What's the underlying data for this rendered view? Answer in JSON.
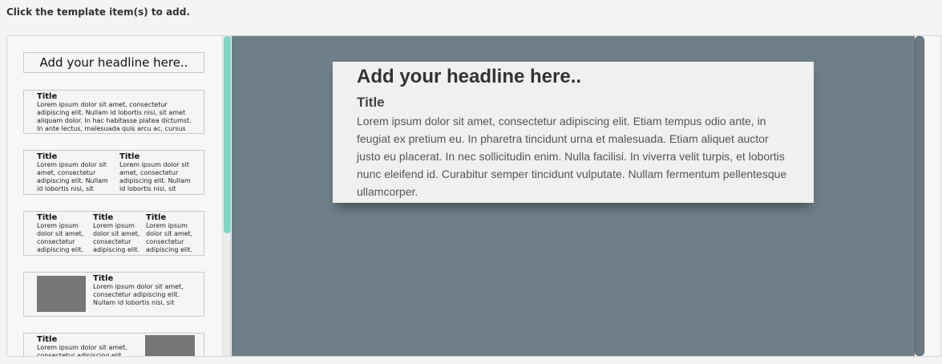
{
  "instruction": "Click the template item(s) to add.",
  "templates": {
    "headline": "Add your headline here..",
    "single": {
      "title": "Title",
      "body": "Lorem ipsum dolor sit amet, consectetur adipiscing elit. Nullam id lobortis nisi, sit amet aliquam dolor. In hac habitasse platea dictumst. In ante lectus, malesuada quis arcu ac, cursus"
    },
    "two_col": [
      {
        "title": "Title",
        "body": "Lorem ipsum dolor sit amet, consectetur adipiscing elit. Nullam id lobortis nisi, sit"
      },
      {
        "title": "Title",
        "body": "Lorem ipsum dolor sit amet, consectetur adipiscing elit. Nullam id lobortis nisi, sit"
      }
    ],
    "three_col": [
      {
        "title": "Title",
        "body": "Lorem ipsum dolor sit amet, consectetur adipiscing elit."
      },
      {
        "title": "Title",
        "body": "Lorem ipsum dolor sit amet, consectetur adipiscing elit."
      },
      {
        "title": "Title",
        "body": "Lorem ipsum dolor sit amet, consectetur adipiscing elit."
      }
    ],
    "image_left": {
      "title": "Title",
      "body": "Lorem ipsum dolor sit amet, consectetur adipiscing elit. Nullam id lobortis nisi, sit"
    },
    "image_right": {
      "title": "Title",
      "body": "Lorem ipsum dolor sit amet, consectetur adipiscing elit."
    }
  },
  "canvas": {
    "headline": "Add your headline here..",
    "title": "Title",
    "body": "Lorem ipsum dolor sit amet, consectetur adipiscing elit. Etiam tempus odio ante, in feugiat ex pretium eu. In pharetra tincidunt urna et malesuada. Etiam aliquet auctor justo eu placerat. In nec sollicitudin enim. Nulla facilisi. In viverra velit turpis, et lobortis nunc eleifend id. Curabitur semper tincidunt vulputate. Nullam fermentum pellentesque ullamcorper."
  },
  "colors": {
    "canvas_bg": "#6f7f89",
    "scroll_accent": "#7ed6c4"
  }
}
